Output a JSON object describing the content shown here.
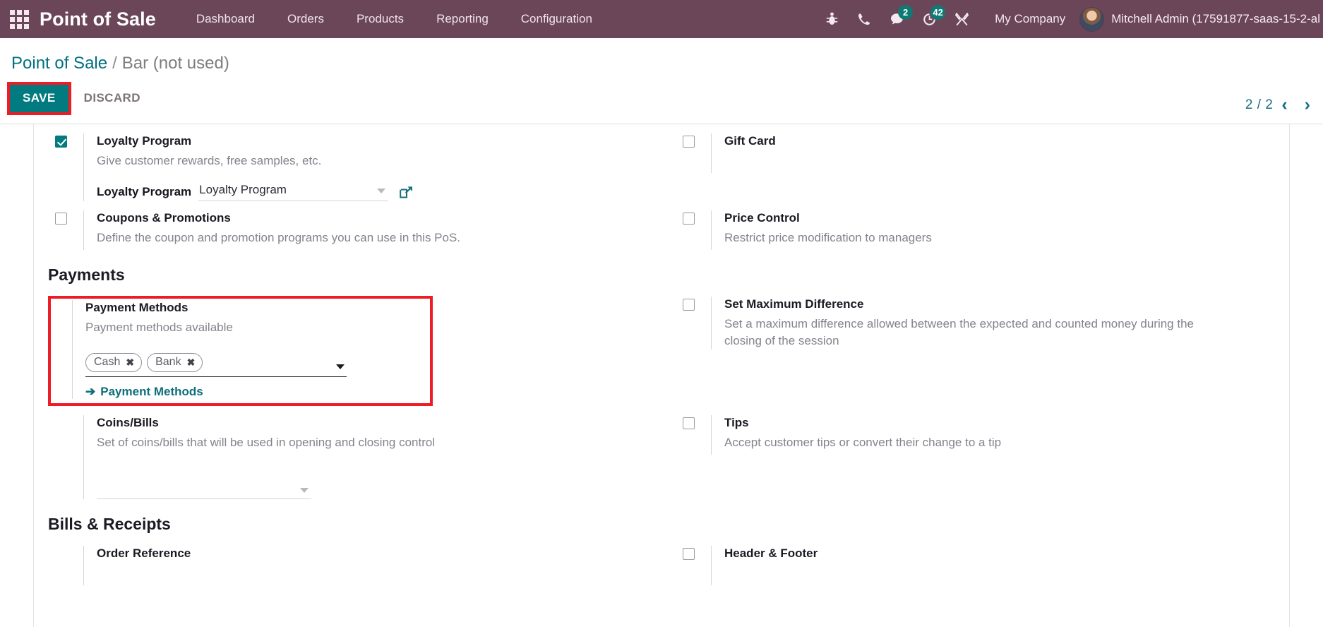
{
  "navbar": {
    "apps_icon": "apps-grid-icon",
    "brand": "Point of Sale",
    "menu": [
      {
        "label": "Dashboard"
      },
      {
        "label": "Orders"
      },
      {
        "label": "Products"
      },
      {
        "label": "Reporting"
      },
      {
        "label": "Configuration"
      }
    ],
    "icons": [
      {
        "name": "bug-icon",
        "badge": null
      },
      {
        "name": "phone-icon",
        "badge": null
      },
      {
        "name": "messages-icon",
        "badge": "2"
      },
      {
        "name": "activities-clock-icon",
        "badge": "42"
      },
      {
        "name": "tools-wrench-icon",
        "badge": null
      }
    ],
    "company": "My Company",
    "user": "Mitchell Admin (17591877-saas-15-2-al",
    "bg_color": "#6b4558",
    "badge_color": "#0e7a74"
  },
  "control_panel": {
    "breadcrumb_root": "Point of Sale",
    "breadcrumb_separator": "/",
    "breadcrumb_current": "Bar (not used)",
    "save_label": "SAVE",
    "discard_label": "DISCARD",
    "pager_count": "2 / 2",
    "pager_prev": "‹",
    "pager_next": "›",
    "save_highlight_color": "#ee1c25",
    "save_bg_color": "#017b7f",
    "accent_color": "#017b7f"
  },
  "settings": {
    "row_loyalty": {
      "left": {
        "checked": true,
        "title": "Loyalty Program",
        "desc": "Give customer rewards, free samples, etc.",
        "subfield_label": "Loyalty Program",
        "subfield_value": "Loyalty Program",
        "external_link_icon": "external-link-icon"
      },
      "right": {
        "checked": false,
        "title": "Gift Card",
        "desc": ""
      }
    },
    "row_coupons": {
      "left": {
        "checked": false,
        "title": "Coupons & Promotions",
        "desc": "Define the coupon and promotion programs you can use in this PoS."
      },
      "right": {
        "checked": false,
        "title": "Price Control",
        "desc": "Restrict price modification to managers"
      }
    },
    "payments_section_title": "Payments",
    "row_payment_methods": {
      "left": {
        "title": "Payment Methods",
        "desc": "Payment methods available",
        "tags": [
          {
            "label": "Cash",
            "remove": "✖"
          },
          {
            "label": "Bank",
            "remove": "✖"
          }
        ],
        "link_label": "Payment Methods",
        "link_arrow": "➔",
        "highlight_color": "#ee1c25"
      },
      "right": {
        "checked": false,
        "title": "Set Maximum Difference",
        "desc": "Set a maximum difference allowed between the expected and counted money during the closing of the session"
      }
    },
    "row_coins": {
      "left": {
        "title": "Coins/Bills",
        "desc": "Set of coins/bills that will be used in opening and closing control",
        "select_value": ""
      },
      "right": {
        "checked": false,
        "title": "Tips",
        "desc": "Accept customer tips or convert their change to a tip"
      }
    },
    "bills_section_title": "Bills & Receipts",
    "row_bills": {
      "left": {
        "title": "Order Reference",
        "desc": ""
      },
      "right": {
        "checked": false,
        "title": "Header & Footer",
        "desc": ""
      }
    }
  }
}
